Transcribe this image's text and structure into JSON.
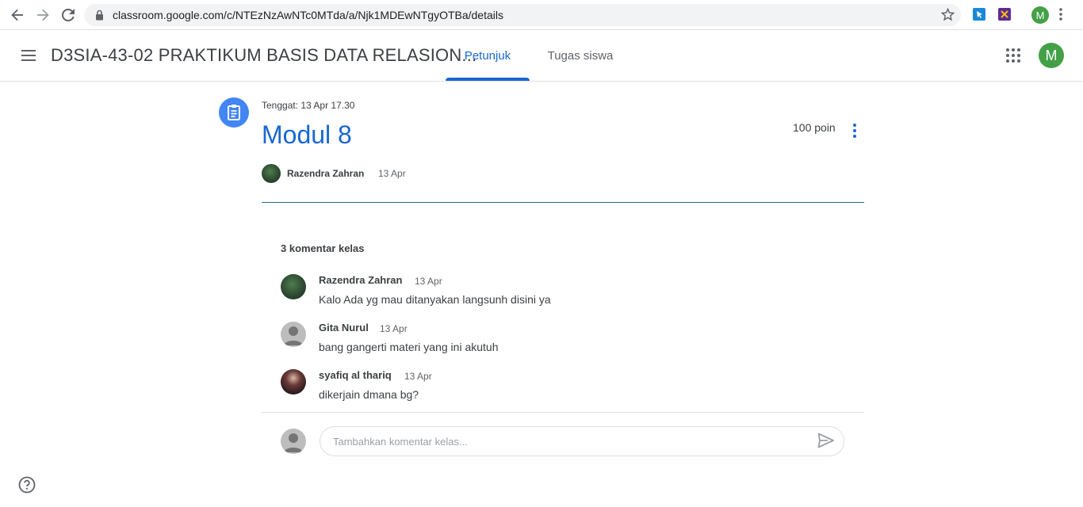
{
  "browser": {
    "url": "classroom.google.com/c/NTEzNzAwNTc0MTda/a/Njk1MDEwNTgyOTBa/details",
    "profile_initial": "M"
  },
  "header": {
    "class_title": "D3SIA-43-02 PRAKTIKUM BASIS DATA RELASION...",
    "tabs": [
      {
        "label": "Petunjuk",
        "active": true
      },
      {
        "label": "Tugas siswa",
        "active": false
      }
    ],
    "avatar_initial": "M"
  },
  "assignment": {
    "due": "Tenggat: 13 Apr 17.30",
    "title": "Modul 8",
    "points": "100 poin",
    "author": "Razendra Zahran",
    "posted_date": "13 Apr"
  },
  "comments": {
    "count_label": "3 komentar kelas",
    "items": [
      {
        "name": "Razendra Zahran",
        "date": "13 Apr",
        "text": "Kalo Ada yg mau ditanyakan langsunh disini ya"
      },
      {
        "name": "Gita Nurul",
        "date": "13 Apr",
        "text": "bang gangerti materi yang ini akutuh"
      },
      {
        "name": "syafiq al thariq",
        "date": "13 Apr",
        "text": "dikerjain dmana bg?"
      }
    ],
    "input_placeholder": "Tambahkan komentar kelas..."
  },
  "colors": {
    "accent": "#1967d2",
    "assignment_icon_bg": "#4285f4",
    "avatar_green": "#43a047"
  }
}
